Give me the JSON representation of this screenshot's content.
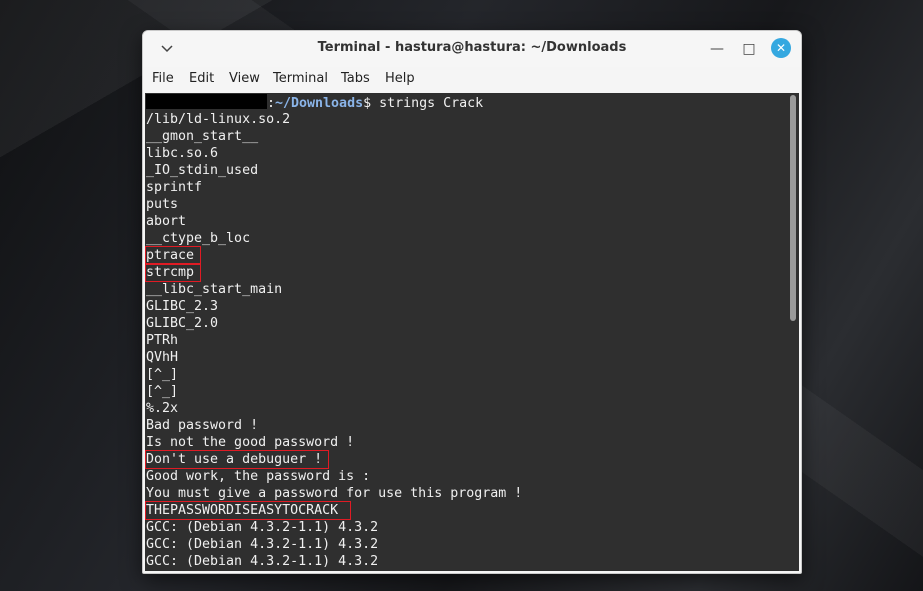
{
  "window": {
    "title": "Terminal - hastura@hastura: ~/Downloads",
    "menu_icon": "chevron-down-icon",
    "minimize_glyph": "—",
    "maximize_glyph": "□",
    "close_glyph": "✕"
  },
  "menubar": {
    "items": [
      "File",
      "Edit",
      "View",
      "Terminal",
      "Tabs",
      "Help"
    ]
  },
  "terminal": {
    "prompt_separator": ":",
    "prompt_path": "~/Downloads",
    "prompt_symbol": "$ ",
    "command": "strings Crack",
    "lines": [
      "/lib/ld-linux.so.2",
      "__gmon_start__",
      "libc.so.6",
      "_IO_stdin_used",
      "sprintf",
      "puts",
      "abort",
      "__ctype_b_loc",
      "ptrace",
      "strcmp",
      "__libc_start_main",
      "GLIBC_2.3",
      "GLIBC_2.0",
      "PTRh",
      "QVhH",
      "[^_]",
      "[^_]",
      "%.2x",
      "Bad password !",
      "Is not the good password !",
      "Don't use a debuguer !",
      "Good work, the password is :",
      "You must give a password for use this program !",
      "THEPASSWORDISEASYTOCRACK",
      "GCC: (Debian 4.3.2-1.1) 4.3.2",
      "GCC: (Debian 4.3.2-1.1) 4.3.2",
      "GCC: (Debian 4.3.2-1.1) 4.3.2"
    ],
    "highlight_color": "#e01b24",
    "scroll_position": 0.48
  },
  "colors": {
    "terminal_bg": "#2f2f2f",
    "terminal_fg": "#f0f0f0",
    "prompt_path": "#8ab4e8",
    "close_button": "#35a8e0"
  }
}
